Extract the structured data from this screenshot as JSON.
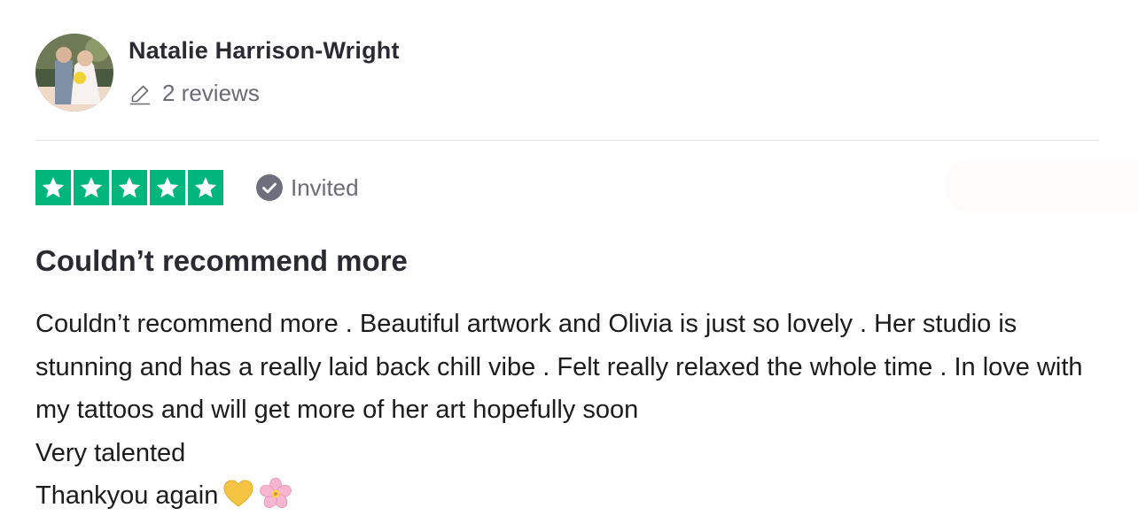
{
  "reviewer": {
    "name": "Natalie Harrison-Wright",
    "reviews_count": "2 reviews"
  },
  "rating": {
    "stars": 5,
    "max_stars": 5,
    "color": "#00b67a"
  },
  "badge": {
    "label": "Invited",
    "icon": "check-circle-icon"
  },
  "review": {
    "title": "Couldn’t recommend more",
    "lines": [
      "Couldn’t recommend more . Beautiful artwork and Olivia is just so lovely . Her studio is stunning and has a really laid back chill vibe . Felt really relaxed the whole time . In love with my tattoos and will get more of her art hopefully soon",
      "Very talented",
      "Thankyou again"
    ],
    "emojis": [
      "yellow-heart-icon",
      "cherry-blossom-icon"
    ]
  }
}
